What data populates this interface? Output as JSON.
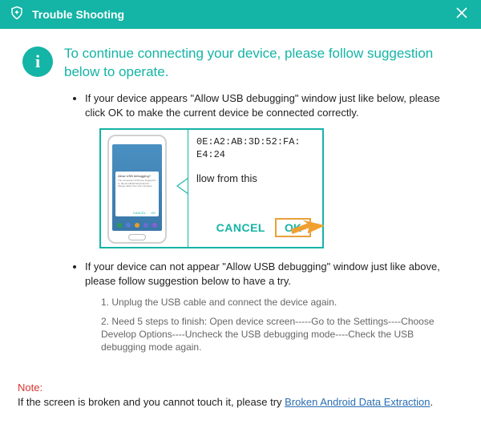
{
  "titlebar": {
    "title": "Trouble Shooting"
  },
  "intro": "To continue connecting your device, please follow suggestion below to operate.",
  "bullets": {
    "first": "If your device appears \"Allow USB debugging\" window just like below, please click OK to make the current device  be connected correctly.",
    "second": "If your device can not appear \"Allow USB debugging\" window just like above, please follow suggestion below to have a try."
  },
  "illustration": {
    "phone_dialog_title": "Allow USB debugging?",
    "phone_dialog_body": "The computer's RSA key fingerprint is: 0E:A2:AB:3D:52:FA:E4:24  Always allow from this computer",
    "phone_cancel": "CANCEL",
    "phone_ok": "OK",
    "panel_mac_line1": "0E:A2:AB:3D:52:FA:",
    "panel_mac_line2": "E4:24",
    "panel_text": "llow from this",
    "cancel": "CANCEL",
    "ok": "OK"
  },
  "steps": {
    "s1": "1. Unplug the USB cable and connect the device again.",
    "s2": "2. Need 5 steps to finish: Open device screen-----Go to the Settings----Choose Develop Options----Uncheck the USB debugging mode----Check the USB debugging mode again."
  },
  "note": {
    "label": "Note:",
    "text_before": "If the screen is broken and you cannot touch it, please try ",
    "link": "Broken Android Data Extraction",
    "text_after": "."
  }
}
